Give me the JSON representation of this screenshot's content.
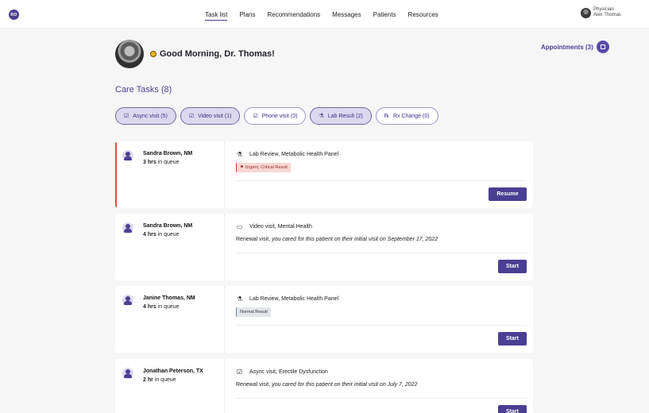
{
  "app": {
    "logo": "RO"
  },
  "nav": [
    "Task list",
    "Plans",
    "Recommendations",
    "Messages",
    "Patients",
    "Resources"
  ],
  "nav_active": 0,
  "user": {
    "role": "Physician",
    "name": "Alex Thomas"
  },
  "greeting": "Good Morning, Dr. Thomas!",
  "appointments": "Appointments (3)",
  "care_tasks_title": "Care Tasks (8)",
  "filters": [
    {
      "icon": "☑",
      "label": "Async visit (5)",
      "selected": true
    },
    {
      "icon": "☑",
      "label": "Video visit (1)",
      "selected": true
    },
    {
      "icon": "☑",
      "label": "Phone visit (0)",
      "selected": false
    },
    {
      "icon": "⚗",
      "label": "Lab Result (2)",
      "selected": true
    },
    {
      "icon": "℞",
      "label": "Rx Change (0)",
      "selected": false
    }
  ],
  "tasks": [
    {
      "patient": "Sandra Brown, NM",
      "queue_time": "3 hrs",
      "queue_suffix": " in queue",
      "visit_icon": "flask-icon",
      "visit": "Lab Review, Metabolic Health Panel",
      "tag": "Urgent, Critical Result",
      "tag_type": "urgent",
      "note_prefix": "",
      "note_italic": "",
      "action": "Resume",
      "urgent": true
    },
    {
      "patient": "Sandra Brown, NM",
      "queue_time": "4 hrs",
      "queue_suffix": " in queue",
      "visit_icon": "video-icon",
      "visit": "Video visit, Mental Health",
      "tag": "",
      "tag_type": "",
      "note_prefix": "Renewal visit, ",
      "note_italic": "you cared for this patient on their initial visit on September 17, 2022",
      "action": "Start",
      "urgent": false
    },
    {
      "patient": "Janine Thomas, NM",
      "queue_time": "4 hrs",
      "queue_suffix": " in queue",
      "visit_icon": "flask-icon",
      "visit": "Lab Review, Metabolic Health Panel",
      "tag": "Normal Result",
      "tag_type": "normal",
      "note_prefix": "",
      "note_italic": "",
      "action": "Start",
      "urgent": false
    },
    {
      "patient": "Jonathan Peterson, TX",
      "queue_time": "2 hr",
      "queue_suffix": " in queue",
      "visit_icon": "checkbox-icon",
      "visit": "Async visit, Erectile Dysfunction",
      "tag": "",
      "tag_type": "",
      "note_prefix": "Renewal visit, ",
      "note_italic": "you cared for this patient on their initial visit on July 7, 2022",
      "action": "Start",
      "urgent": false
    }
  ],
  "colors": {
    "accent": "#4b3f93",
    "urgent": "#e0493f"
  }
}
